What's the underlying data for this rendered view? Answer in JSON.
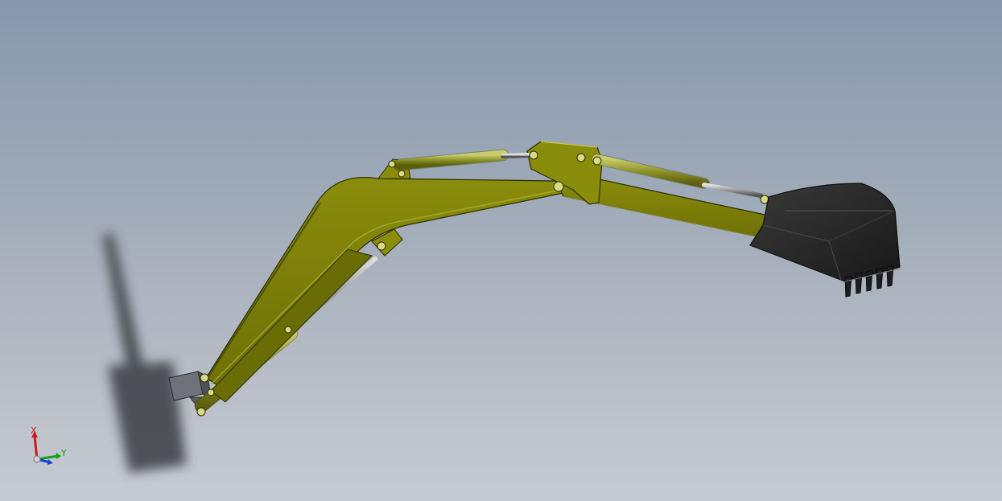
{
  "viewport": {
    "background_top": "#8797ac",
    "background_bottom": "#c7cbd2"
  },
  "model": {
    "boom_color": "#7b7d08",
    "boom_shadow_color": "#5f6106",
    "cylinder_color": "#8d9228",
    "rod_color": "#9a9a9a",
    "bucket_color": "#262626",
    "mount_color": "#6f7379"
  },
  "triad": {
    "x_label": "X",
    "y_label": "Y",
    "x_color": "#d01818",
    "y_color": "#10a010",
    "z_color": "#1a3fd8"
  }
}
